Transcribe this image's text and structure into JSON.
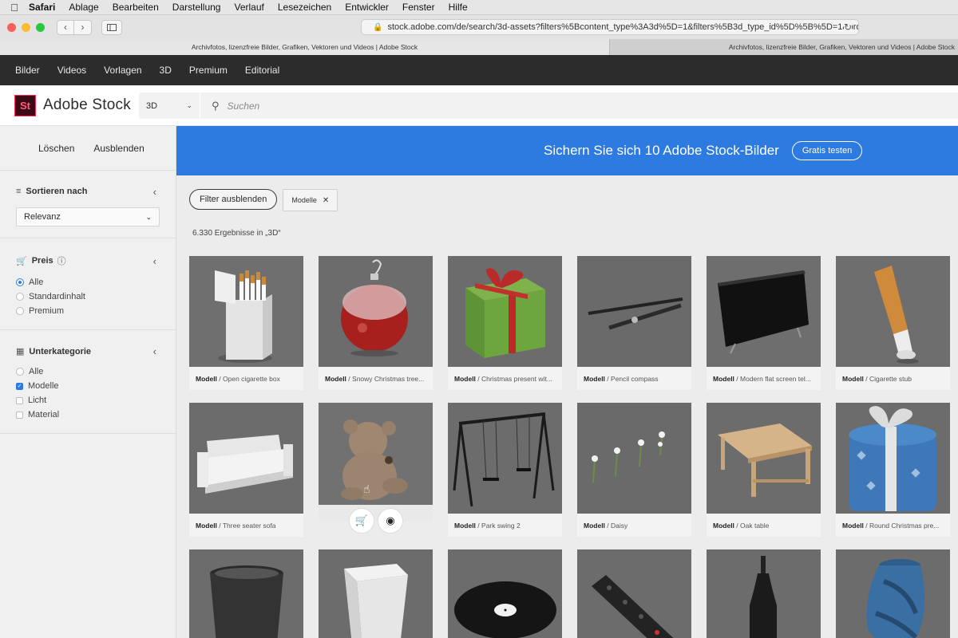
{
  "menubar": {
    "items": [
      "Safari",
      "Ablage",
      "Bearbeiten",
      "Darstellung",
      "Verlauf",
      "Lesezeichen",
      "Entwickler",
      "Fenster",
      "Hilfe"
    ]
  },
  "browser": {
    "url": "stock.adobe.com/de/search/3d-assets?filters%5Bcontent_type%3A3d%5D=1&filters%5B3d_type_id%5D%5B%5D=1&order=",
    "tabs": [
      "Archivfotos, lizenzfreie Bilder, Grafiken, Vektoren und Videos | Adobe Stock",
      "Archivfotos, lizenzfreie Bilder, Grafiken, Vektoren und Videos | Adobe Stock"
    ]
  },
  "sitenav": {
    "items": [
      "Bilder",
      "Videos",
      "Vorlagen",
      "3D",
      "Premium",
      "Editorial"
    ]
  },
  "header": {
    "logo_text": "St",
    "brand": "Adobe Stock",
    "type_select": "3D",
    "search_placeholder": "Suchen"
  },
  "sidebar": {
    "clear_label": "Löschen",
    "hide_label": "Ausblenden",
    "sort": {
      "title": "Sortieren nach",
      "value": "Relevanz"
    },
    "price": {
      "title": "Preis",
      "options": [
        "Alle",
        "Standardinhalt",
        "Premium"
      ],
      "selected": 0
    },
    "subcategory": {
      "title": "Unterkategorie",
      "options": [
        "Alle",
        "Modelle",
        "Licht",
        "Material"
      ],
      "checked": 1
    }
  },
  "banner": {
    "text": "Sichern Sie sich 10 Adobe Stock-Bilder",
    "button": "Gratis testen"
  },
  "filters": {
    "hide_button": "Filter ausblenden",
    "chip": "Modelle"
  },
  "results_text": "6.330 Ergebnisse in „3D“",
  "cards": [
    {
      "type": "Modell",
      "title": "/ Open cigarette box"
    },
    {
      "type": "Modell",
      "title": "/ Snowy Christmas tree..."
    },
    {
      "type": "Modell",
      "title": "/ Christmas present wit..."
    },
    {
      "type": "Modell",
      "title": "/ Pencil compass"
    },
    {
      "type": "Modell",
      "title": "/ Modern flat screen tel..."
    },
    {
      "type": "Modell",
      "title": "/ Cigarette stub"
    },
    {
      "type": "Modell",
      "title": "/ Three seater sofa"
    },
    {
      "type": "",
      "title": ""
    },
    {
      "type": "Modell",
      "title": "/ Park swing 2"
    },
    {
      "type": "Modell",
      "title": "/ Daisy"
    },
    {
      "type": "Modell",
      "title": "/ Oak table"
    },
    {
      "type": "Modell",
      "title": "/ Round Christmas pre..."
    }
  ],
  "colors": {
    "accent": "#2d7ae0",
    "nav_bg": "#2c2c2c",
    "brand_red": "#ff2a55"
  }
}
